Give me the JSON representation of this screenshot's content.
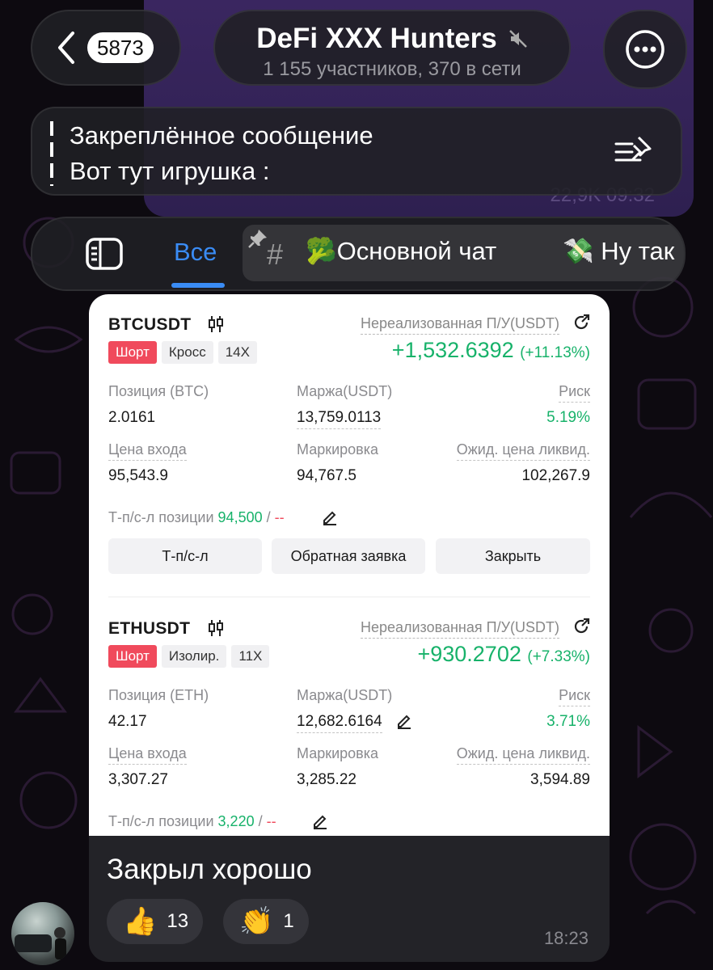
{
  "header": {
    "back_count": "5873",
    "chat_title": "DeFi XXX Hunters",
    "chat_subtitle": "1 155 участников, 370 в сети",
    "muted_icon": "muted-speaker-icon",
    "menu_icon": "more-dots-icon"
  },
  "pinned": {
    "title": "Закреплённое сообщение",
    "text": "Вот тут игрушка :"
  },
  "previous_message": {
    "meta": "22,9K 09:32"
  },
  "tabs": {
    "all_label": "Все",
    "topic_main": "🥦Основной чат",
    "topic_next": "💸 Ну так",
    "accent": "#3a8cf5"
  },
  "positions": [
    {
      "symbol": "BTCUSDT",
      "upnl_label": "Нереализованная П/У(USDT)",
      "side": "Шорт",
      "margin_mode": "Кросс",
      "leverage": "14X",
      "pnl": "+1,532.6392",
      "pnl_pct": "(+11.13%)",
      "size_label": "Позиция (BTC)",
      "size": "2.0161",
      "margin_label": "Маржа(USDT)",
      "margin": "13,759.0113",
      "risk_label": "Риск",
      "risk": "5.19%",
      "entry_label": "Цена входа",
      "entry": "95,543.9",
      "mark_label": "Маркировка",
      "mark": "94,767.5",
      "liq_label": "Ожид. цена ликвид.",
      "liq": "102,267.9",
      "tpsl_label": "Т-п/с-л позиции",
      "tp": "94,500",
      "sep": " / ",
      "sl": "--",
      "btn_tpsl": "Т-п/с-л",
      "btn_reverse": "Обратная заявка",
      "btn_close": "Закрыть"
    },
    {
      "symbol": "ETHUSDT",
      "upnl_label": "Нереализованная П/У(USDT)",
      "side": "Шорт",
      "margin_mode": "Изолир.",
      "leverage": "11X",
      "pnl": "+930.2702",
      "pnl_pct": "(+7.33%)",
      "size_label": "Позиция (ETH)",
      "size": "42.17",
      "margin_label": "Маржа(USDT)",
      "margin": "12,682.6164",
      "risk_label": "Риск",
      "risk": "3.71%",
      "entry_label": "Цена входа",
      "entry": "3,307.27",
      "mark_label": "Маркировка",
      "mark": "3,285.22",
      "liq_label": "Ожид. цена ликвид.",
      "liq": "3,594.89",
      "tpsl_label": "Т-п/с-л позиции",
      "tp": "3,220",
      "sep": " / ",
      "sl": "--"
    }
  ],
  "message": {
    "text": "Закрыл хорошо",
    "reactions": [
      {
        "emoji": "👍",
        "count": "13"
      },
      {
        "emoji": "👏",
        "count": "1"
      }
    ],
    "time": "18:23"
  },
  "colors": {
    "profit": "#17b26a",
    "short": "#f04a5c",
    "background": "#0d0a10"
  }
}
